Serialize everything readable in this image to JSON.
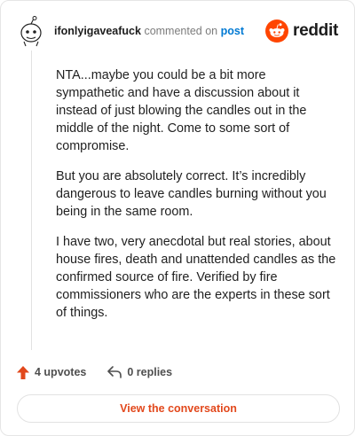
{
  "comment": {
    "username": "ifonlyigaveafuck",
    "action_text": "commented on",
    "post_link": "post",
    "paragraphs": [
      "NTA...maybe you could be a bit more sympathetic and have a discussion about it instead of just blowing the candles out in the middle of the night. Come to some sort of compromise.",
      "But you are absolutely correct. It’s incredibly dangerous to leave candles burning without you being in the same room.",
      "I have two, very anecdotal but real stories, about house fires, death and unattended candles as the confirmed source of fire. Verified by fire commissioners who are the experts in these sort of things."
    ]
  },
  "logo": {
    "wordmark": "reddit",
    "icon": "reddit-snoo-icon"
  },
  "actions": {
    "upvotes_label": "4 upvotes",
    "replies_label": "0 replies",
    "upvote_icon": "upvote-arrow-icon",
    "reply_icon": "reply-arrow-icon"
  },
  "cta": {
    "label": "View the conversation"
  },
  "colors": {
    "accent": "#e2481c",
    "reddit_orange": "#ff4500",
    "link": "#0079d3"
  }
}
